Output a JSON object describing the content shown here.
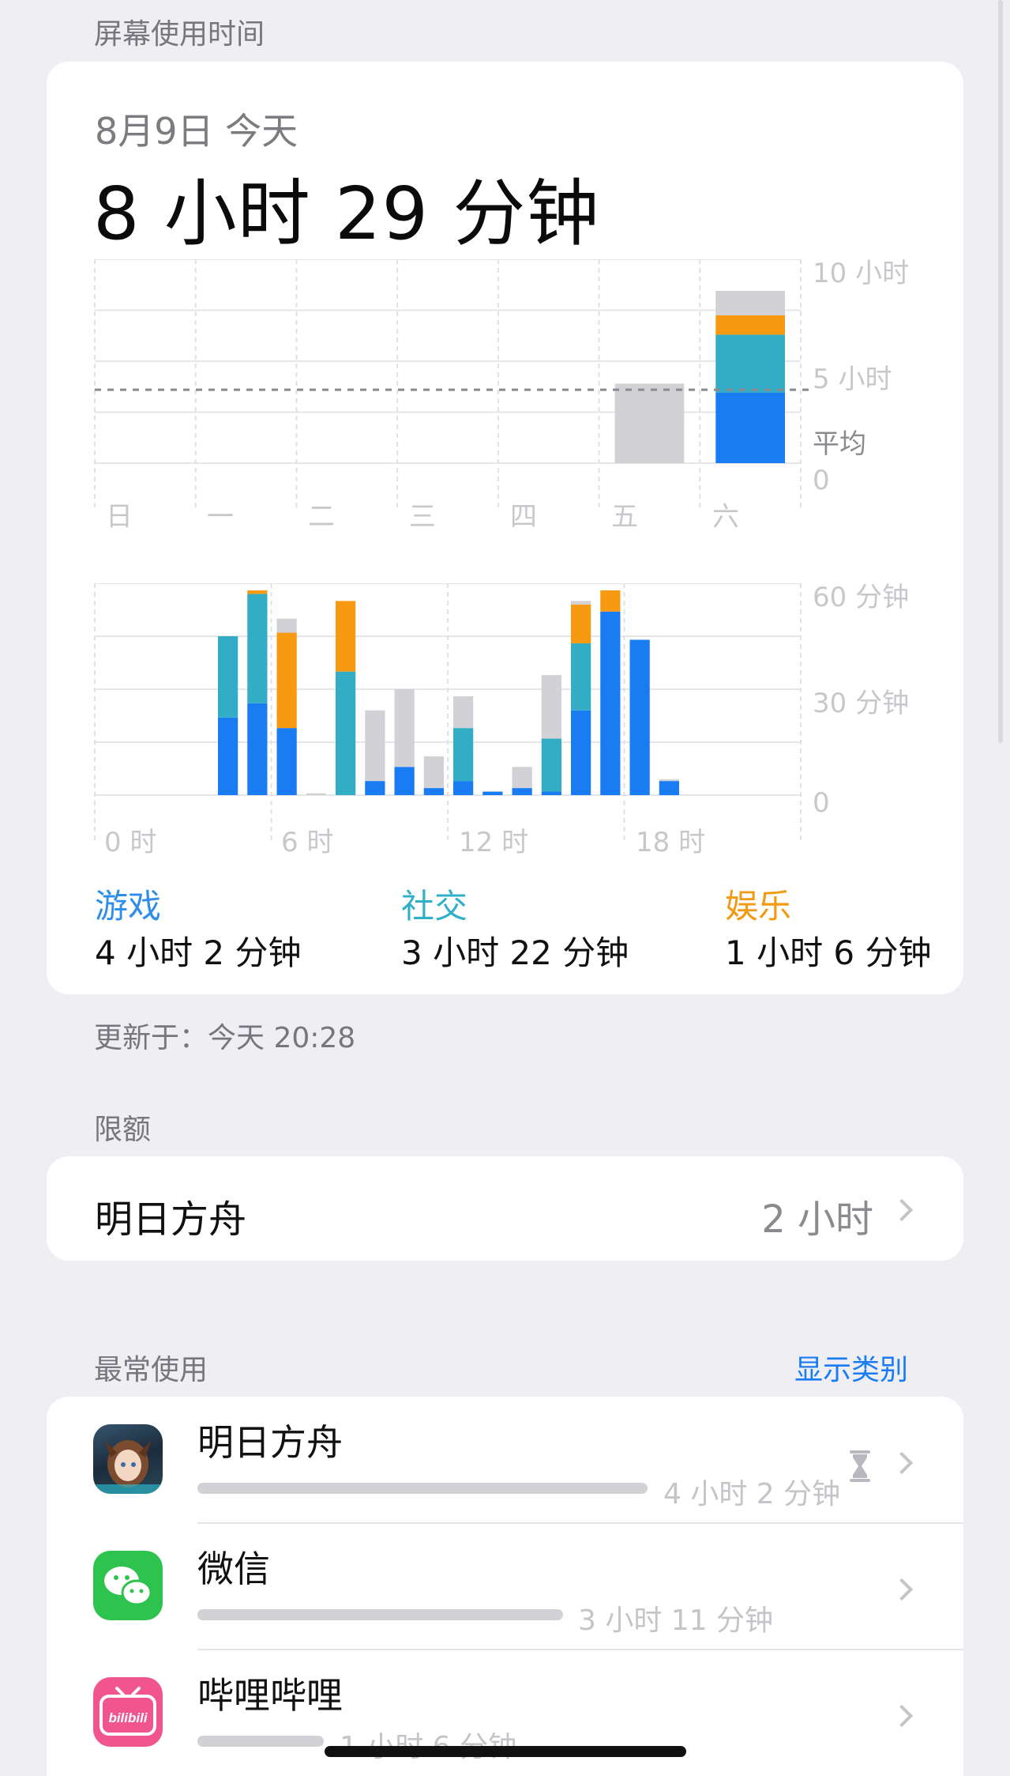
{
  "header": {
    "title": "屏幕使用时间"
  },
  "summary": {
    "date": "8月9日 今天",
    "total": "8 小时 29 分钟"
  },
  "weekly_chart": {
    "type": "bar",
    "y_max_hours": 10,
    "y_ticks": [
      "10 小时",
      "5 小时",
      "0"
    ],
    "average_label": "平均",
    "average_hours": 3.6,
    "categories": [
      "日",
      "一",
      "二",
      "三",
      "四",
      "五",
      "六"
    ],
    "series": [
      {
        "name": "游戏",
        "values": [
          0,
          0,
          0,
          0,
          0,
          0,
          3.45
        ]
      },
      {
        "name": "社交",
        "values": [
          0,
          0,
          0,
          0,
          0,
          0,
          2.85
        ]
      },
      {
        "name": "娱乐",
        "values": [
          0,
          0,
          0,
          0,
          0,
          0,
          0.95
        ]
      },
      {
        "name": "other",
        "values": [
          0,
          0,
          0,
          0,
          0,
          3.9,
          1.2
        ]
      }
    ]
  },
  "hourly_chart": {
    "type": "bar",
    "y_max_minutes": 60,
    "y_ticks": [
      "60 分钟",
      "30 分钟",
      "0"
    ],
    "x_ticks": [
      "0 时",
      "6 时",
      "12 时",
      "18 时"
    ],
    "hours": [
      4,
      5,
      6,
      7,
      8,
      9,
      10,
      11,
      12,
      13,
      14,
      15,
      16,
      17,
      18,
      19,
      20,
      21
    ],
    "series": [
      {
        "name": "游戏",
        "values": [
          22,
          26,
          19,
          0,
          0,
          4,
          8,
          2,
          4,
          1,
          2,
          1,
          24,
          52,
          44,
          4,
          0,
          0
        ]
      },
      {
        "name": "社交",
        "values": [
          23,
          31,
          0,
          0,
          35,
          0,
          0,
          0,
          15,
          0,
          0,
          15,
          19,
          0,
          0,
          0,
          0,
          0
        ]
      },
      {
        "name": "娱乐",
        "values": [
          0,
          1,
          27,
          0,
          20,
          0,
          0,
          0,
          0,
          0,
          0,
          0,
          11,
          6,
          0,
          0,
          0,
          0
        ]
      },
      {
        "name": "other",
        "values": [
          0,
          0,
          4,
          0.5,
          0,
          20,
          22,
          9,
          9,
          0,
          6,
          18,
          1,
          0,
          0,
          0.5,
          0,
          0
        ]
      }
    ]
  },
  "categories_summary": [
    {
      "name": "游戏",
      "value": "4 小时 2 分钟",
      "color": "#2f8fe8"
    },
    {
      "name": "社交",
      "value": "3 小时 22 分钟",
      "color": "#2fb0c9"
    },
    {
      "name": "娱乐",
      "value": "1 小时 6 分钟",
      "color": "#f29a12"
    }
  ],
  "updated": "更新于：今天 20:28",
  "limits": {
    "label": "限额",
    "item": {
      "name": "明日方舟",
      "value": "2 小时"
    }
  },
  "most_used": {
    "label": "最常使用",
    "show_categories": "显示类别",
    "apps": [
      {
        "name": "明日方舟",
        "time": "4 小时 2 分钟",
        "fraction": 1.0,
        "icon": "arknights-icon",
        "has_limit": true
      },
      {
        "name": "微信",
        "time": "3 小时 11 分钟",
        "fraction": 0.79,
        "icon": "wechat-icon",
        "has_limit": false
      },
      {
        "name": "哔哩哔哩",
        "time": "1 小时 6 分钟",
        "fraction": 0.27,
        "icon": "bilibili-icon",
        "has_limit": false
      }
    ]
  },
  "colors": {
    "game": "#1a7cf2",
    "social": "#33adc6",
    "entertainment": "#f79a12",
    "other": "#d1d1d6",
    "link": "#1a7cf2"
  }
}
